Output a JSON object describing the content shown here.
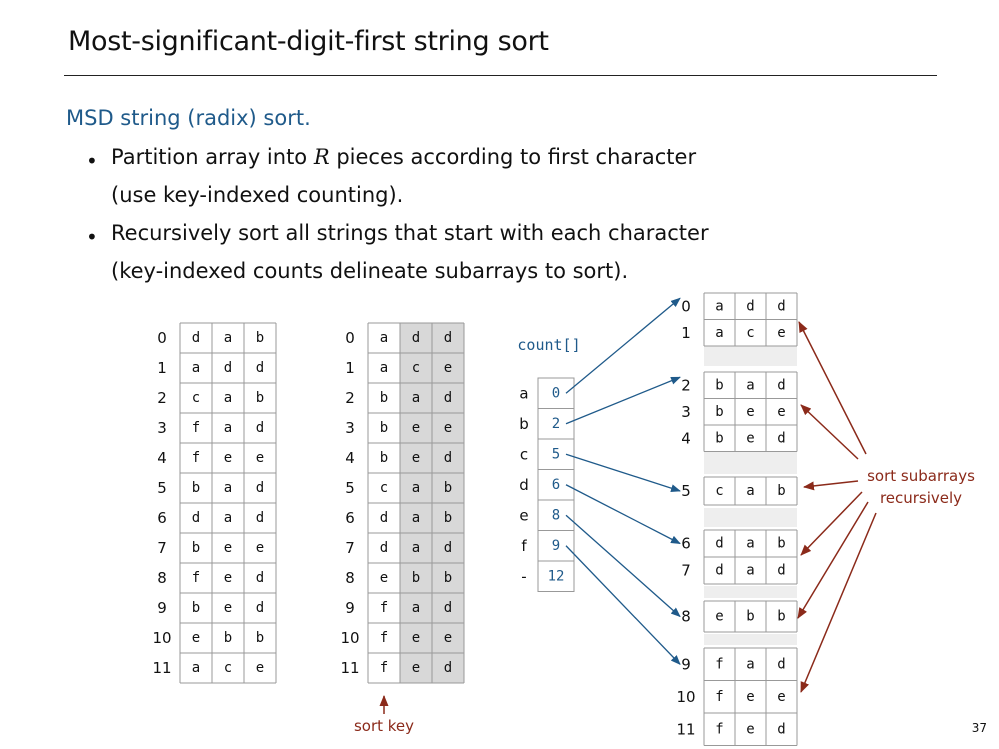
{
  "slide": {
    "title": "Most-significant-digit-first string sort",
    "heading": "MSD string (radix) sort.",
    "bullets": [
      {
        "line1_pre": "Partition array into ",
        "line1_math": "R",
        "line1_post": " pieces according to first character",
        "line2": "(use key-indexed counting)."
      },
      {
        "line1_pre": "Recursively sort all strings that start with each character",
        "line1_math": "",
        "line1_post": "",
        "line2": "(key-indexed counts delineate subarrays to sort)."
      }
    ],
    "page_number": "37"
  },
  "colors": {
    "accent_blue": "#1f5a8a",
    "accent_red": "#8b2a1a",
    "key_shade": "#d8d8d8",
    "gap_shade": "#eeeeee"
  },
  "arrays": {
    "original": [
      [
        "d",
        "a",
        "b"
      ],
      [
        "a",
        "d",
        "d"
      ],
      [
        "c",
        "a",
        "b"
      ],
      [
        "f",
        "a",
        "d"
      ],
      [
        "f",
        "e",
        "e"
      ],
      [
        "b",
        "a",
        "d"
      ],
      [
        "d",
        "a",
        "d"
      ],
      [
        "b",
        "e",
        "e"
      ],
      [
        "f",
        "e",
        "d"
      ],
      [
        "b",
        "e",
        "d"
      ],
      [
        "e",
        "b",
        "b"
      ],
      [
        "a",
        "c",
        "e"
      ]
    ],
    "partitioned": [
      [
        "a",
        "d",
        "d"
      ],
      [
        "a",
        "c",
        "e"
      ],
      [
        "b",
        "a",
        "d"
      ],
      [
        "b",
        "e",
        "e"
      ],
      [
        "b",
        "e",
        "d"
      ],
      [
        "c",
        "a",
        "b"
      ],
      [
        "d",
        "a",
        "b"
      ],
      [
        "d",
        "a",
        "d"
      ],
      [
        "e",
        "b",
        "b"
      ],
      [
        "f",
        "a",
        "d"
      ],
      [
        "f",
        "e",
        "e"
      ],
      [
        "f",
        "e",
        "d"
      ]
    ]
  },
  "sort_key_label": "sort key",
  "count": {
    "label": "count[]",
    "keys": [
      "a",
      "b",
      "c",
      "d",
      "e",
      "f",
      "-"
    ],
    "values": [
      "0",
      "2",
      "5",
      "6",
      "8",
      "9",
      "12"
    ]
  },
  "subarrays": [
    {
      "rows": [
        {
          "index": "0",
          "chars": [
            "a",
            "d",
            "d"
          ]
        },
        {
          "index": "1",
          "chars": [
            "a",
            "c",
            "e"
          ]
        }
      ]
    },
    {
      "rows": [
        {
          "index": "2",
          "chars": [
            "b",
            "a",
            "d"
          ]
        },
        {
          "index": "3",
          "chars": [
            "b",
            "e",
            "e"
          ]
        },
        {
          "index": "4",
          "chars": [
            "b",
            "e",
            "d"
          ]
        }
      ]
    },
    {
      "rows": [
        {
          "index": "5",
          "chars": [
            "c",
            "a",
            "b"
          ]
        }
      ]
    },
    {
      "rows": [
        {
          "index": "6",
          "chars": [
            "d",
            "a",
            "b"
          ]
        },
        {
          "index": "7",
          "chars": [
            "d",
            "a",
            "d"
          ]
        }
      ]
    },
    {
      "rows": [
        {
          "index": "8",
          "chars": [
            "e",
            "b",
            "b"
          ]
        }
      ]
    },
    {
      "rows": [
        {
          "index": "9",
          "chars": [
            "f",
            "a",
            "d"
          ]
        },
        {
          "index": "10",
          "chars": [
            "f",
            "e",
            "e"
          ]
        },
        {
          "index": "11",
          "chars": [
            "f",
            "e",
            "d"
          ]
        }
      ]
    }
  ],
  "recursion_label": {
    "line1": "sort subarrays",
    "line2": "recursively"
  }
}
